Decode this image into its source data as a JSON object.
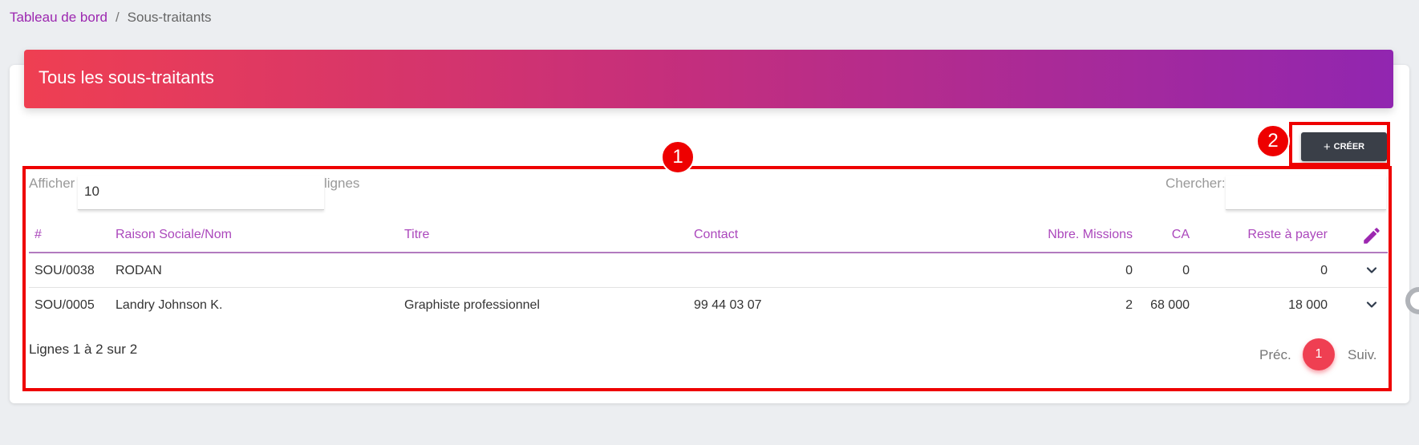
{
  "breadcrumb": {
    "home": "Tableau de bord",
    "separator": "/",
    "current": "Sous-traitants"
  },
  "card": {
    "title": "Tous les sous-traitants"
  },
  "toolbar": {
    "create_label": "CRÉER",
    "create_icon": "plus-icon"
  },
  "markers": {
    "one": "1",
    "two": "2"
  },
  "table_controls": {
    "show_label": "Afficher",
    "page_size": "10",
    "rows_label": "lignes",
    "search_label": "Chercher:",
    "search_value": ""
  },
  "table": {
    "headers": {
      "id": "#",
      "name": "Raison Sociale/Nom",
      "title": "Titre",
      "contact": "Contact",
      "missions": "Nbre. Missions",
      "ca": "CA",
      "remaining": "Reste à payer"
    },
    "rows": [
      {
        "id": "SOU/0038",
        "name": "RODAN",
        "title": "",
        "contact": "",
        "missions": "0",
        "ca": "0",
        "remaining": "0"
      },
      {
        "id": "SOU/0005",
        "name": "Landry Johnson K.",
        "title": "Graphiste professionnel",
        "contact": "99 44 03 07",
        "missions": "2",
        "ca": "68 000",
        "remaining": "18 000"
      }
    ]
  },
  "pagination": {
    "info": "Lignes 1 à 2 sur 2",
    "prev": "Préc.",
    "current_page": "1",
    "next": "Suiv."
  },
  "colors": {
    "accent": "#9c27b0",
    "header_start": "#ef3f52",
    "header_end": "#9126b0",
    "annotation": "#ee0000",
    "button": "#3a3f48"
  }
}
